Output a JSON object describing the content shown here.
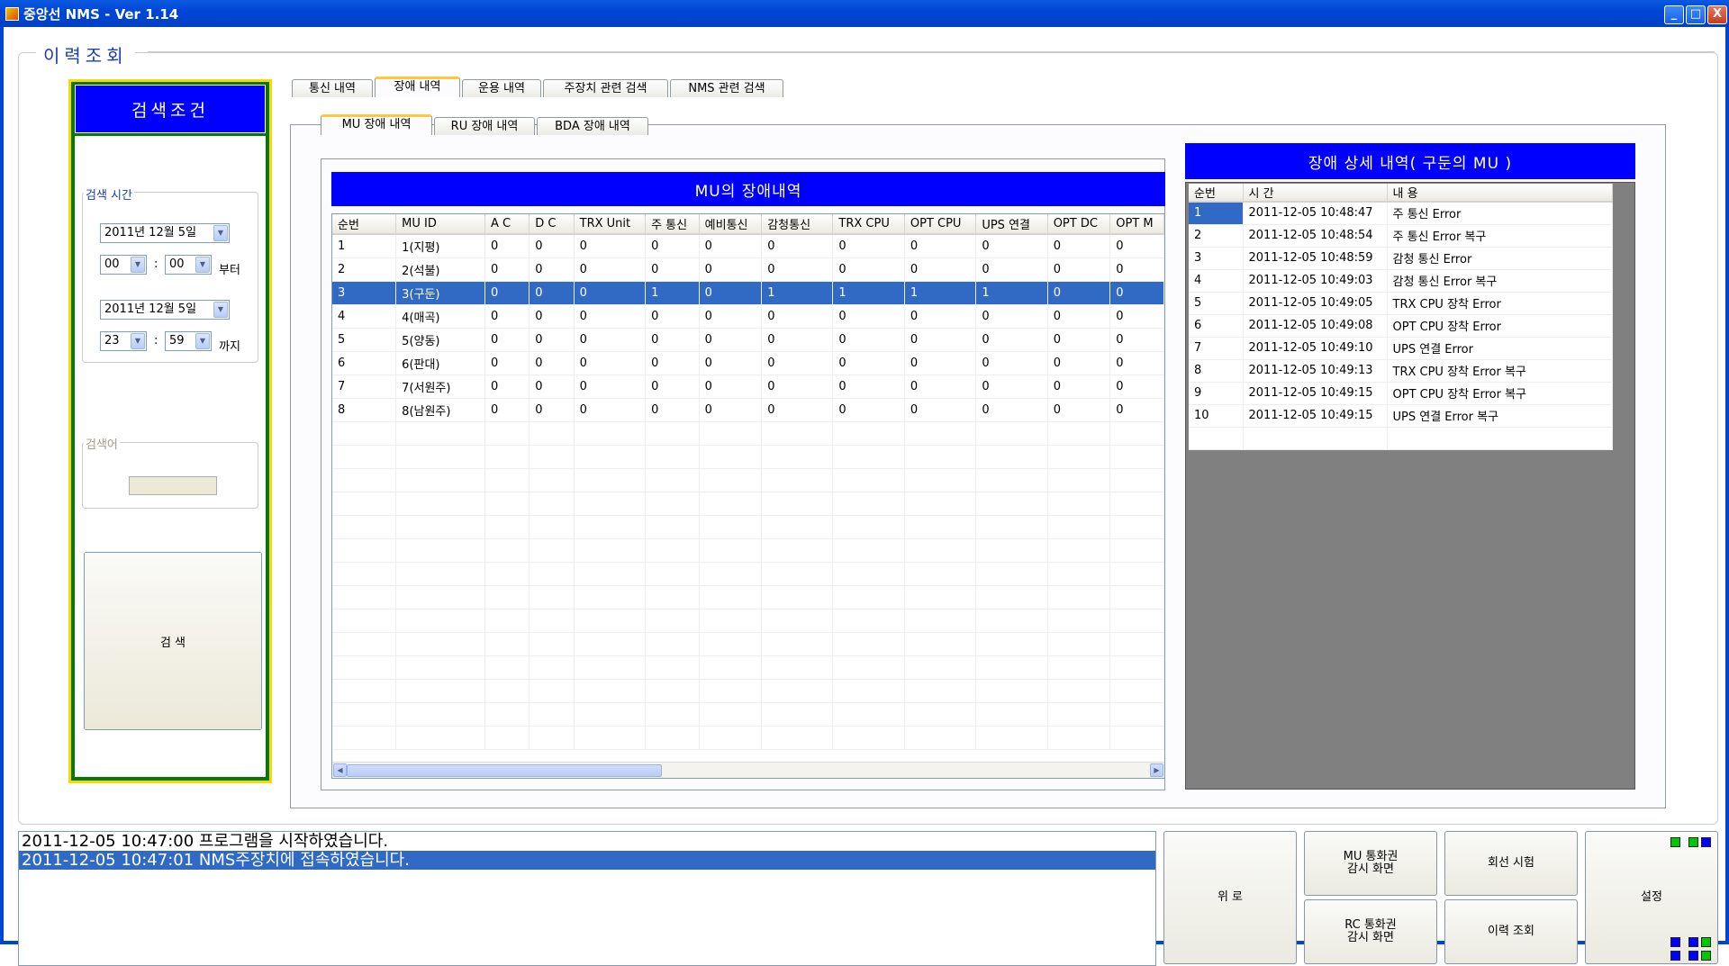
{
  "window": {
    "title": "중앙선 NMS  - Ver 1.14",
    "min": "_",
    "max": "□",
    "close": "X"
  },
  "page_title": "이력조회",
  "search": {
    "header": "검색조건",
    "time_group": "검색 시간",
    "from_date": "2011년 12월   5일",
    "from_hour": "00",
    "from_min": "00",
    "from_suffix": "부터",
    "to_date": "2011년 12월   5일",
    "to_hour": "23",
    "to_min": "59",
    "to_suffix": "까지",
    "colon": ":",
    "keyword_group": "검색어",
    "keyword_value": "",
    "search_button": "검 색"
  },
  "tabs": [
    "통신 내역",
    "장애 내역",
    "운용 내역",
    "주장치 관련 검색",
    "NMS 관련 검색"
  ],
  "subtabs": [
    "MU 장애 내역",
    "RU 장애 내역",
    "BDA 장애 내역"
  ],
  "mu_table": {
    "title": "MU의 장애내역",
    "columns": [
      "순번",
      "MU ID",
      "A C",
      "D C",
      "TRX Unit",
      "주 통신",
      "예비통신",
      "감청통신",
      "TRX CPU",
      "OPT CPU",
      "UPS 연결",
      "OPT DC",
      "OPT M"
    ],
    "rows": [
      [
        "1",
        "1(지평)",
        "0",
        "0",
        "0",
        "0",
        "0",
        "0",
        "0",
        "0",
        "0",
        "0",
        "0"
      ],
      [
        "2",
        "2(석불)",
        "0",
        "0",
        "0",
        "0",
        "0",
        "0",
        "0",
        "0",
        "0",
        "0",
        "0"
      ],
      [
        "3",
        "3(구둔)",
        "0",
        "0",
        "0",
        "1",
        "0",
        "1",
        "1",
        "1",
        "1",
        "0",
        "0"
      ],
      [
        "4",
        "4(매곡)",
        "0",
        "0",
        "0",
        "0",
        "0",
        "0",
        "0",
        "0",
        "0",
        "0",
        "0"
      ],
      [
        "5",
        "5(양동)",
        "0",
        "0",
        "0",
        "0",
        "0",
        "0",
        "0",
        "0",
        "0",
        "0",
        "0"
      ],
      [
        "6",
        "6(판대)",
        "0",
        "0",
        "0",
        "0",
        "0",
        "0",
        "0",
        "0",
        "0",
        "0",
        "0"
      ],
      [
        "7",
        "7(서원주)",
        "0",
        "0",
        "0",
        "0",
        "0",
        "0",
        "0",
        "0",
        "0",
        "0",
        "0"
      ],
      [
        "8",
        "8(남원주)",
        "0",
        "0",
        "0",
        "0",
        "0",
        "0",
        "0",
        "0",
        "0",
        "0",
        "0"
      ]
    ],
    "selected_row": 3
  },
  "detail": {
    "title": "장애 상세 내역( 구둔의 MU )",
    "columns": [
      "순번",
      "시 간",
      "내 용"
    ],
    "rows": [
      [
        "1",
        "2011-12-05 10:48:47",
        "주 통신 Error"
      ],
      [
        "2",
        "2011-12-05 10:48:54",
        "주 통신 Error 복구"
      ],
      [
        "3",
        "2011-12-05 10:48:59",
        "감청 통신 Error"
      ],
      [
        "4",
        "2011-12-05 10:49:03",
        "감청 통신 Error 복구"
      ],
      [
        "5",
        "2011-12-05 10:49:05",
        "TRX CPU 장착 Error"
      ],
      [
        "6",
        "2011-12-05 10:49:08",
        "OPT CPU 장착 Error"
      ],
      [
        "7",
        "2011-12-05 10:49:10",
        "UPS 연결 Error"
      ],
      [
        "8",
        "2011-12-05 10:49:13",
        "TRX CPU 장착 Error 복구"
      ],
      [
        "9",
        "2011-12-05 10:49:15",
        "OPT CPU 장착 Error 복구"
      ],
      [
        "10",
        "2011-12-05 10:49:15",
        "UPS 연결 Error 복구"
      ]
    ]
  },
  "log": [
    "2011-12-05 10:47:00 프로그램을 시작하였습니다.",
    "2011-12-05 10:47:01 NMS주장치에 접속하였습니다."
  ],
  "buttons": {
    "wiro": "위 로",
    "mu_monitor": "MU 통화권\n감시 화면",
    "rc_monitor": "RC 통화권\n감시 화면",
    "line_test": "회선 시험",
    "history": "이력 조회",
    "settings": "설정"
  },
  "colors": {
    "header_blue": "#0000ff",
    "selection": "#316ac5",
    "panel_green": "#007a00",
    "panel_gold": "#ffd700",
    "status_green": "#00c800",
    "status_blue": "#0000ff"
  }
}
